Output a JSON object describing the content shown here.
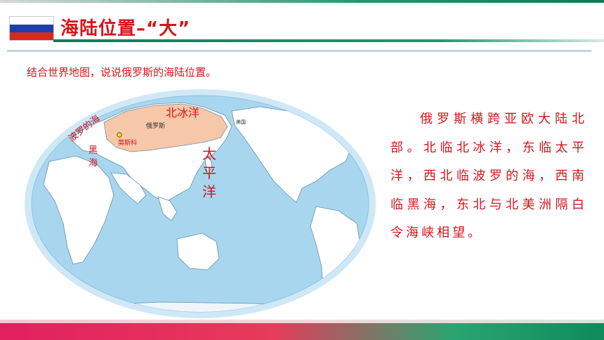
{
  "header": {
    "title": "海陆位置–“大”",
    "flag_colors": [
      "#ffffff",
      "#1e3fa8",
      "#d52b1e"
    ]
  },
  "prompt": "结合世界地图，说说俄罗斯的海陆位置。",
  "map": {
    "labels": {
      "russia": "俄罗斯",
      "moscow": "莫斯科",
      "arctic_ocean": "北冰洋",
      "pacific_1": "太",
      "pacific_2": "平",
      "pacific_3": "洋",
      "baltic_sea": "波罗的海",
      "black_sea_1": "黑",
      "black_sea_2": "海",
      "usa": "美国"
    },
    "colors": {
      "ocean": "#a8d6ef",
      "land": "#ffffff",
      "russia": "#f6c7a8",
      "rim": "#cfe8f6"
    }
  },
  "answer": {
    "indent": "  ",
    "text": "俄罗斯横跨亚欧大陆北部。北临北冰洋，东临太平洋，西北临波罗的海，西南临黑海，东北与北美洲隔白令海峡相望。"
  }
}
